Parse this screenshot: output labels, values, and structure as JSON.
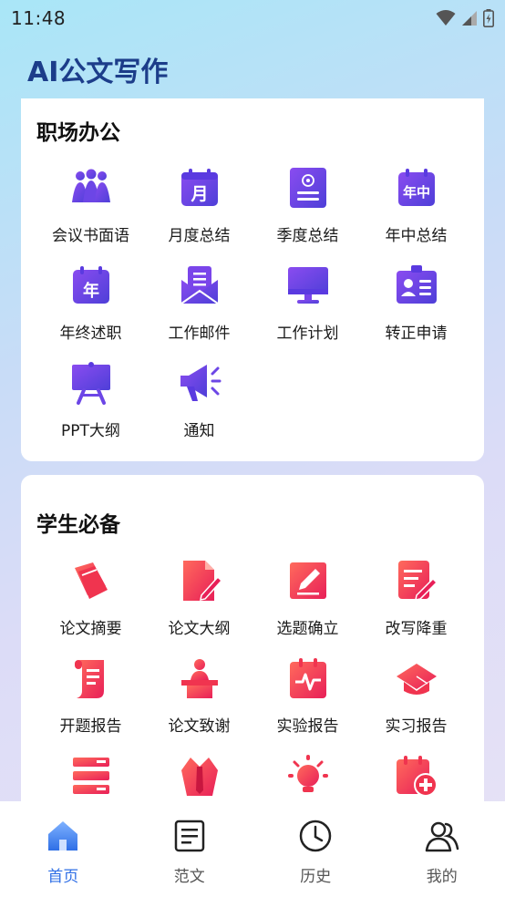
{
  "status_bar": {
    "time": "11:48",
    "icons": [
      "wifi-icon",
      "cellular-icon",
      "battery-icon"
    ]
  },
  "app": {
    "title": "AI公文写作"
  },
  "colors": {
    "brand": "#1c3d8a",
    "purple": "#6f3fe0",
    "red": "#f0344f",
    "active_tab": "#2f6fe6"
  },
  "section_office": {
    "title": "职场办公",
    "items": [
      {
        "label": "会议书面语",
        "icon": "meeting-people-icon"
      },
      {
        "label": "月度总结",
        "icon": "calendar-month-icon",
        "glyph": "月"
      },
      {
        "label": "季度总结",
        "icon": "quarter-document-icon"
      },
      {
        "label": "年中总结",
        "icon": "calendar-midyear-icon",
        "glyph": "年中"
      },
      {
        "label": "年终述职",
        "icon": "calendar-year-icon",
        "glyph": "年"
      },
      {
        "label": "工作邮件",
        "icon": "mail-icon"
      },
      {
        "label": "工作计划",
        "icon": "monitor-icon"
      },
      {
        "label": "转正申请",
        "icon": "id-badge-icon"
      },
      {
        "label": "PPT大纲",
        "icon": "presentation-board-icon"
      },
      {
        "label": "通知",
        "icon": "megaphone-icon"
      }
    ]
  },
  "section_student": {
    "title": "学生必备",
    "items": [
      {
        "label": "论文摘要",
        "icon": "book-icon"
      },
      {
        "label": "论文大纲",
        "icon": "document-pen-icon"
      },
      {
        "label": "选题确立",
        "icon": "edit-square-icon"
      },
      {
        "label": "改写降重",
        "icon": "document-edit-icon"
      },
      {
        "label": "开题报告",
        "icon": "scroll-icon"
      },
      {
        "label": "论文致谢",
        "icon": "speaker-podium-icon"
      },
      {
        "label": "实验报告",
        "icon": "clipboard-pulse-icon"
      },
      {
        "label": "实习报告",
        "icon": "graduation-cap-icon"
      },
      {
        "label": "",
        "icon": "stacked-bars-icon"
      },
      {
        "label": "",
        "icon": "shirt-tie-icon"
      },
      {
        "label": "",
        "icon": "lightbulb-icon"
      },
      {
        "label": "",
        "icon": "calendar-plus-icon"
      }
    ]
  },
  "tabbar": {
    "tabs": [
      {
        "label": "首页",
        "icon": "home-icon",
        "active": true
      },
      {
        "label": "范文",
        "icon": "document-list-icon",
        "active": false
      },
      {
        "label": "历史",
        "icon": "clock-icon",
        "active": false
      },
      {
        "label": "我的",
        "icon": "users-icon",
        "active": false
      }
    ]
  }
}
